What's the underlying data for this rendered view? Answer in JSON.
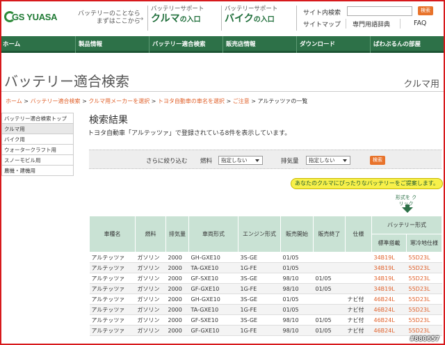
{
  "header": {
    "logo_text": "GS YUASA",
    "intro_line1": "バッテリーのことなら",
    "intro_line2": "まずはここから",
    "intro_arrow": "→",
    "car_small": "バッテリーサポート",
    "car_big": "クルマ",
    "car_suffix": "の入口",
    "bike_small": "バッテリーサポート",
    "bike_big": "バイク",
    "bike_suffix": "の入口",
    "site_search_label": "サイト内検索",
    "search_button": "検索",
    "sitemap": "サイトマップ",
    "glossary": "専門用語辞典",
    "faq": "FAQ"
  },
  "nav": {
    "items": [
      "ホーム",
      "製品情報",
      "バッテリー適合検索",
      "販売店情報",
      "ダウンロード",
      "ばわぶるんの部屋"
    ]
  },
  "page": {
    "title": "バッテリー適合検索",
    "subtitle": "クルマ用"
  },
  "breadcrumb": {
    "items": [
      "ホーム",
      "バッテリー適合検索",
      "クルマ用メーカーを選択",
      "トヨタ自動車の車名を選択",
      "ご注意"
    ],
    "current": "アルテッツァの一覧",
    "separator": " > "
  },
  "sidebar": {
    "items": [
      "バッテリー適合検索トップ",
      "クルマ用",
      "バイク用",
      "ウォータークラフト用",
      "スノーモビル用",
      "農機・建機用"
    ]
  },
  "results": {
    "title": "検索結果",
    "description": "トヨタ自動車「アルテッツァ」で登録されている8件を表示しています。"
  },
  "filter": {
    "label": "さらに絞り込む",
    "fuel_label": "燃料",
    "fuel_value": "指定しない",
    "displacement_label": "排気量",
    "displacement_value": "指定しない",
    "button": "検索"
  },
  "banner": "あなたのクルマにぴったりなバッテリーをご提案します。",
  "click_hint": "形式を クリック",
  "table": {
    "headers": [
      "車種名",
      "燃料",
      "排気量",
      "車両形式",
      "エンジン形式",
      "販売開始",
      "販売終了",
      "仕様"
    ],
    "group_header": "バッテリー形式",
    "sub_headers": [
      "標準搭載",
      "寒冷地仕様"
    ],
    "rows": [
      [
        "アルテッツァ",
        "ガソリン",
        "2000",
        "GH-GXE10",
        "3S-GE",
        "01/05",
        "",
        "",
        "34B19L",
        "55D23L"
      ],
      [
        "アルテッツァ",
        "ガソリン",
        "2000",
        "TA-GXE10",
        "1G-FE",
        "01/05",
        "",
        "",
        "34B19L",
        "55D23L"
      ],
      [
        "アルテッツァ",
        "ガソリン",
        "2000",
        "GF-SXE10",
        "3S-GE",
        "98/10",
        "01/05",
        "",
        "34B19L",
        "55D23L"
      ],
      [
        "アルテッツァ",
        "ガソリン",
        "2000",
        "GF-GXE10",
        "1G-FE",
        "98/10",
        "01/05",
        "",
        "34B19L",
        "55D23L"
      ],
      [
        "アルテッツァ",
        "ガソリン",
        "2000",
        "GH-GXE10",
        "3S-GE",
        "01/05",
        "",
        "ナビ付",
        "46B24L",
        "55D23L"
      ],
      [
        "アルテッツァ",
        "ガソリン",
        "2000",
        "TA-GXE10",
        "1G-FE",
        "01/05",
        "",
        "ナビ付",
        "46B24L",
        "55D23L"
      ],
      [
        "アルテッツァ",
        "ガソリン",
        "2000",
        "GF-SXE10",
        "3S-GE",
        "98/10",
        "01/05",
        "ナビ付",
        "46B24L",
        "55D23L"
      ],
      [
        "アルテッツァ",
        "ガソリン",
        "2000",
        "GF-GXE10",
        "1G-FE",
        "98/10",
        "01/05",
        "ナビ付",
        "46B24L",
        "55D23L"
      ]
    ]
  },
  "stamp": "#880657",
  "colors": {
    "brand_green": "#2d7148",
    "accent_orange": "#e8732b",
    "link_orange": "#e0602a",
    "frame_red": "#d7191c"
  }
}
